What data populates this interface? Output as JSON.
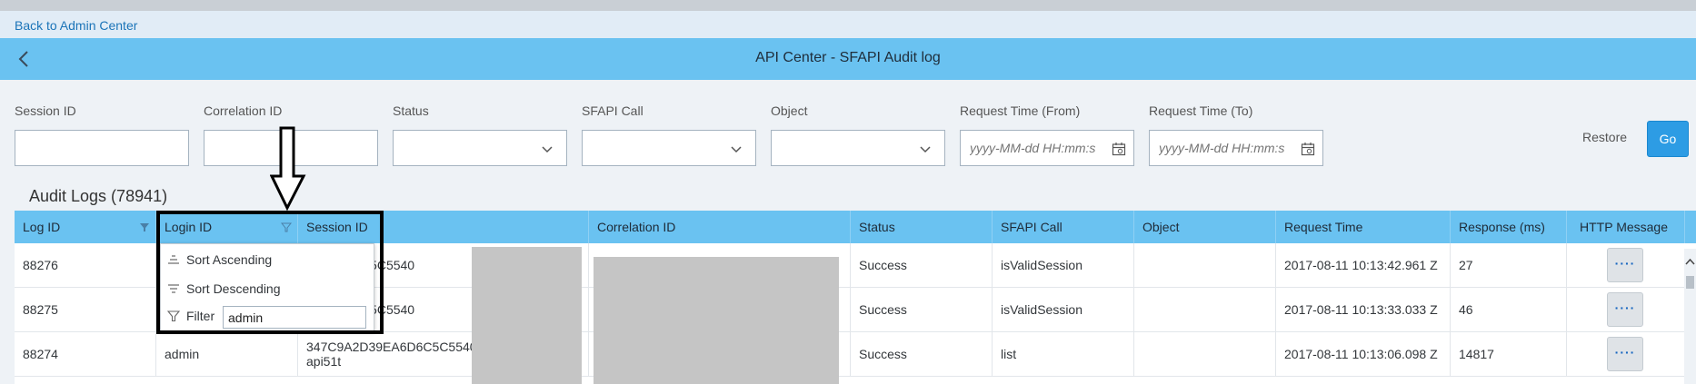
{
  "nav": {
    "back_link": "Back to Admin Center"
  },
  "header": {
    "title": "API Center - SFAPI Audit log"
  },
  "filters": {
    "session_id": {
      "label": "Session ID",
      "value": ""
    },
    "correlation_id": {
      "label": "Correlation ID",
      "value": ""
    },
    "status": {
      "label": "Status",
      "value": ""
    },
    "sfapi_call": {
      "label": "SFAPI Call",
      "value": ""
    },
    "object": {
      "label": "Object",
      "value": ""
    },
    "request_time_from": {
      "label": "Request Time (From)",
      "placeholder": "yyyy-MM-dd HH:mm:s"
    },
    "request_time_to": {
      "label": "Request Time (To)",
      "placeholder": "yyyy-MM-dd HH:mm:s"
    },
    "restore_label": "Restore",
    "go_label": "Go"
  },
  "table": {
    "title": "Audit Logs (78941)",
    "columns": [
      "Log ID",
      "Login ID",
      "Session ID",
      "Correlation ID",
      "Status",
      "SFAPI Call",
      "Object",
      "Request Time",
      "Response (ms)",
      "HTTP Message"
    ],
    "rows": [
      {
        "log_id": "88276",
        "login_id": "",
        "session_id": "39EA6D6C5C5540",
        "session_id_2": "",
        "correlation_id": "",
        "status": "Success",
        "sfapi_call": "isValidSession",
        "object": "",
        "request_time": "2017-08-11 10:13:42.961 Z",
        "response_ms": "27",
        "http_message": "····"
      },
      {
        "log_id": "88275",
        "login_id": "",
        "session_id": "39EA6D6C5C5540",
        "session_id_2": "",
        "correlation_id": "",
        "status": "Success",
        "sfapi_call": "isValidSession",
        "object": "",
        "request_time": "2017-08-11 10:13:33.033 Z",
        "response_ms": "46",
        "http_message": "····"
      },
      {
        "log_id": "88274",
        "login_id": "admin",
        "session_id": "347C9A2D39EA6D6C5C5540",
        "session_id_2": "api51t",
        "correlation_id": "",
        "status": "Success",
        "sfapi_call": "list",
        "object": "",
        "request_time": "2017-08-11 10:13:06.098 Z",
        "response_ms": "14817",
        "http_message": "····"
      }
    ]
  },
  "column_menu": {
    "sort_ascending": "Sort Ascending",
    "sort_descending": "Sort Descending",
    "filter_label": "Filter",
    "filter_value": "admin"
  }
}
